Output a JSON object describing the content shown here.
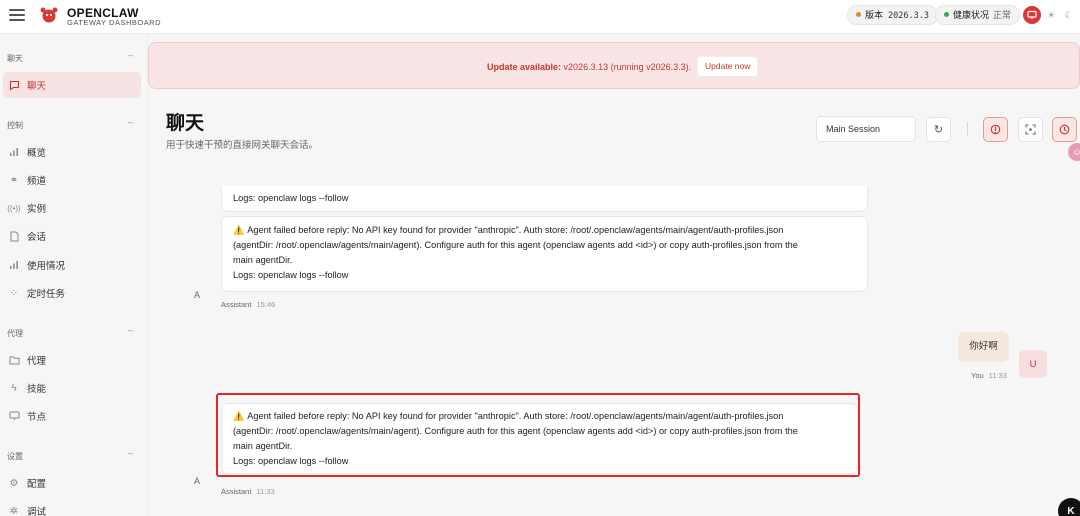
{
  "header": {
    "brand_title": "OPENCLAW",
    "brand_subtitle": "GATEWAY DASHBOARD",
    "version_label": "版本",
    "version_value": "2026.3.3",
    "health_label": "健康状况",
    "health_value": "正常",
    "accent_color": "#d83a3a"
  },
  "sidebar": {
    "groups": [
      {
        "label": "聊天",
        "items": [
          {
            "label": "聊天",
            "icon": "chat-bubble-icon",
            "active": true
          }
        ]
      },
      {
        "label": "控制",
        "items": [
          {
            "label": "概览",
            "icon": "bar-chart-icon"
          },
          {
            "label": "频道",
            "icon": "link-icon"
          },
          {
            "label": "实例",
            "icon": "radio-icon"
          },
          {
            "label": "会话",
            "icon": "document-icon"
          },
          {
            "label": "使用情况",
            "icon": "bar-chart-icon"
          },
          {
            "label": "定时任务",
            "icon": "loader-icon"
          }
        ]
      },
      {
        "label": "代理",
        "items": [
          {
            "label": "代理",
            "icon": "folder-icon"
          },
          {
            "label": "技能",
            "icon": "bolt-icon"
          },
          {
            "label": "节点",
            "icon": "monitor-icon"
          }
        ]
      },
      {
        "label": "设置",
        "items": [
          {
            "label": "配置",
            "icon": "gear-icon"
          },
          {
            "label": "调试",
            "icon": "bug-icon"
          }
        ]
      }
    ]
  },
  "banner": {
    "strong": "Update available:",
    "text": "v2026.3.13 (running v2026.3.3).",
    "button": "Update now"
  },
  "page": {
    "title": "聊天",
    "subtitle": "用于快速干预的直接网关聊天会话。",
    "session": "Main Session"
  },
  "chat": {
    "partial_line": "Logs: openclaw logs --follow",
    "messages": [
      {
        "role": "assistant",
        "avatar": "A",
        "lines": [
          "Agent failed before reply: No API key found for provider \"anthropic\". Auth store: /root/.openclaw/agents/main/agent/auth-profiles.json",
          "(agentDir: /root/.openclaw/agents/main/agent). Configure auth for this agent (openclaw agents add <id>) or copy auth-profiles.json from the",
          "main agentDir.",
          "Logs: openclaw logs --follow"
        ],
        "sender": "Assistant",
        "time": "15:46"
      },
      {
        "role": "user",
        "avatar": "U",
        "text": "你好啊",
        "sender": "You",
        "time": "11:33"
      },
      {
        "role": "assistant",
        "avatar": "A",
        "lines": [
          "Agent failed before reply: No API key found for provider \"anthropic\". Auth store: /root/.openclaw/agents/main/agent/auth-profiles.json",
          "(agentDir: /root/.openclaw/agents/main/agent). Configure auth for this agent (openclaw agents add <id>) or copy auth-profiles.json from the",
          "main agentDir.",
          "Logs: openclaw logs --follow"
        ],
        "sender": "Assistant",
        "time": "11:33"
      }
    ]
  },
  "corner_badge": "K"
}
